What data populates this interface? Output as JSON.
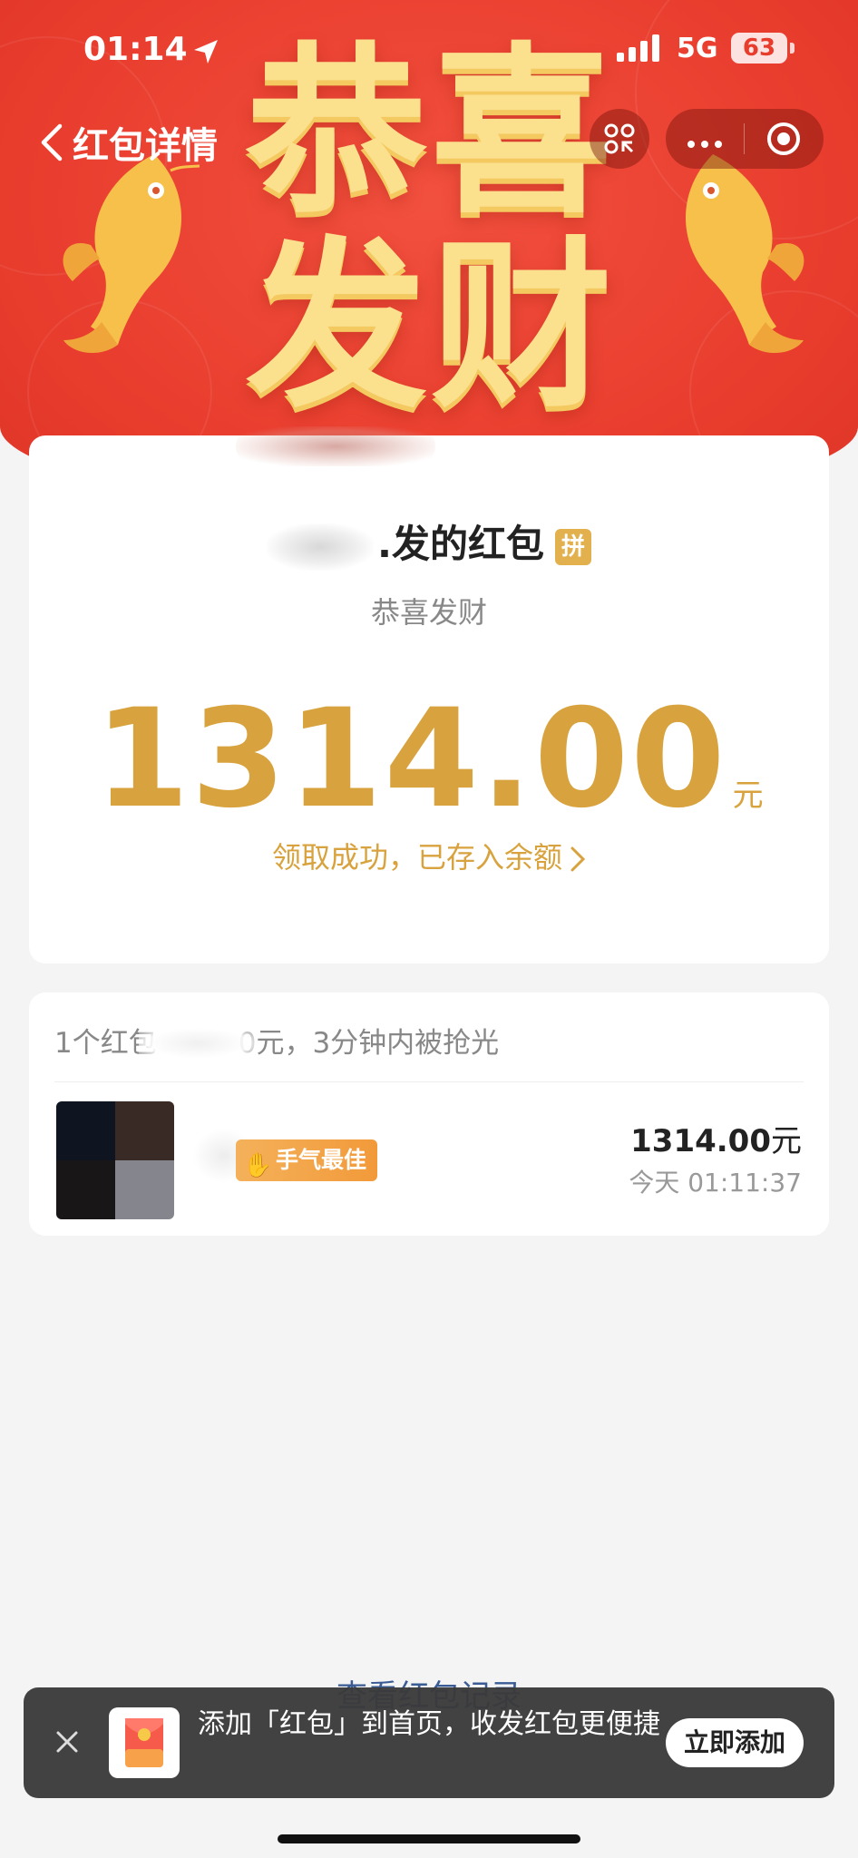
{
  "status_bar": {
    "time": "01:14",
    "network": "5G",
    "battery": "63"
  },
  "nav": {
    "back_label": "红包详情"
  },
  "banner": {
    "title": "恭喜发财"
  },
  "envelope": {
    "sender_suffix": ".发的红包",
    "badge": "拼",
    "wish": "恭喜发财",
    "amount": "1314.00",
    "unit": "元",
    "deposit_text": "领取成功，已存入余额"
  },
  "summary": {
    "prefix": "1个红包",
    "suffix": "0元，3分钟内被抢光"
  },
  "records": [
    {
      "badge": "手气最佳",
      "amount": "1314.00",
      "unit": "元",
      "time": "今天 01:11:37"
    }
  ],
  "footer": {
    "view_record": "查看红包记录"
  },
  "toast": {
    "message": "添加「红包」到首页，收发红包更便捷",
    "button": "立即添加"
  }
}
